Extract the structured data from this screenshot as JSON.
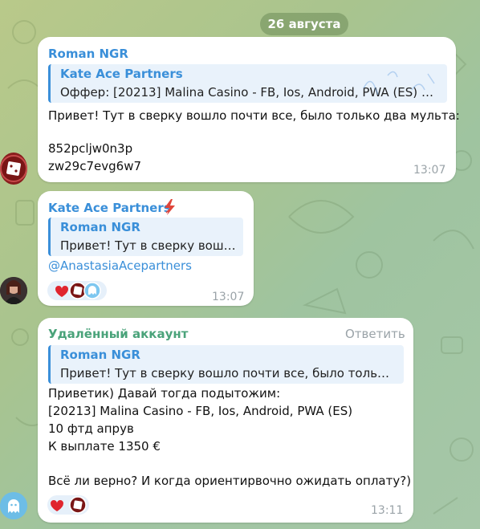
{
  "date_separator": "26 августа",
  "messages": [
    {
      "sender": "Roman NGR",
      "reply": {
        "name": "Kate Ace Partners",
        "text": "Оффер: [20213] Malina Casino - FB, Ios, Android, PWA (ES) 12 ..."
      },
      "lines": [
        "Привет! Тут в сверку вошло почти все, было только два мульта:",
        "",
        "852pcljw0n3p",
        "zw29c7evg6w7"
      ],
      "time": "13:07"
    },
    {
      "sender": "Kate Ace Partners",
      "reply": {
        "name": "Roman NGR",
        "text": "Привет! Тут в сверку вошл..."
      },
      "mention": "@AnastasiaAcepartners",
      "time": "13:07"
    },
    {
      "sender": "Удалённый аккаунт",
      "reply_action": "Ответить",
      "reply": {
        "name": "Roman NGR",
        "text": "Привет! Тут в сверку вошло почти все, было только ..."
      },
      "lines": [
        "Приветик) Давай тогда подытожим:",
        "[20213] Malina Casino - FB, Ios, Android, PWA (ES)",
        "10 фтд апрув",
        "К выплате 1350 €",
        "",
        "Всё ли верно? И когда ориентирвочно ожидать оплату?)"
      ],
      "time": "13:11"
    }
  ],
  "colors": {
    "sender_roman": "#3a8fd9",
    "sender_kate": "#3a8fd9",
    "sender_deleted": "#4aa37a",
    "reply_bar": "#3a8fd9",
    "timestamp": "#9aa3a8"
  },
  "icons": [
    "lightning-badge-icon",
    "heart-reaction-icon",
    "ghost-avatar-icon"
  ]
}
